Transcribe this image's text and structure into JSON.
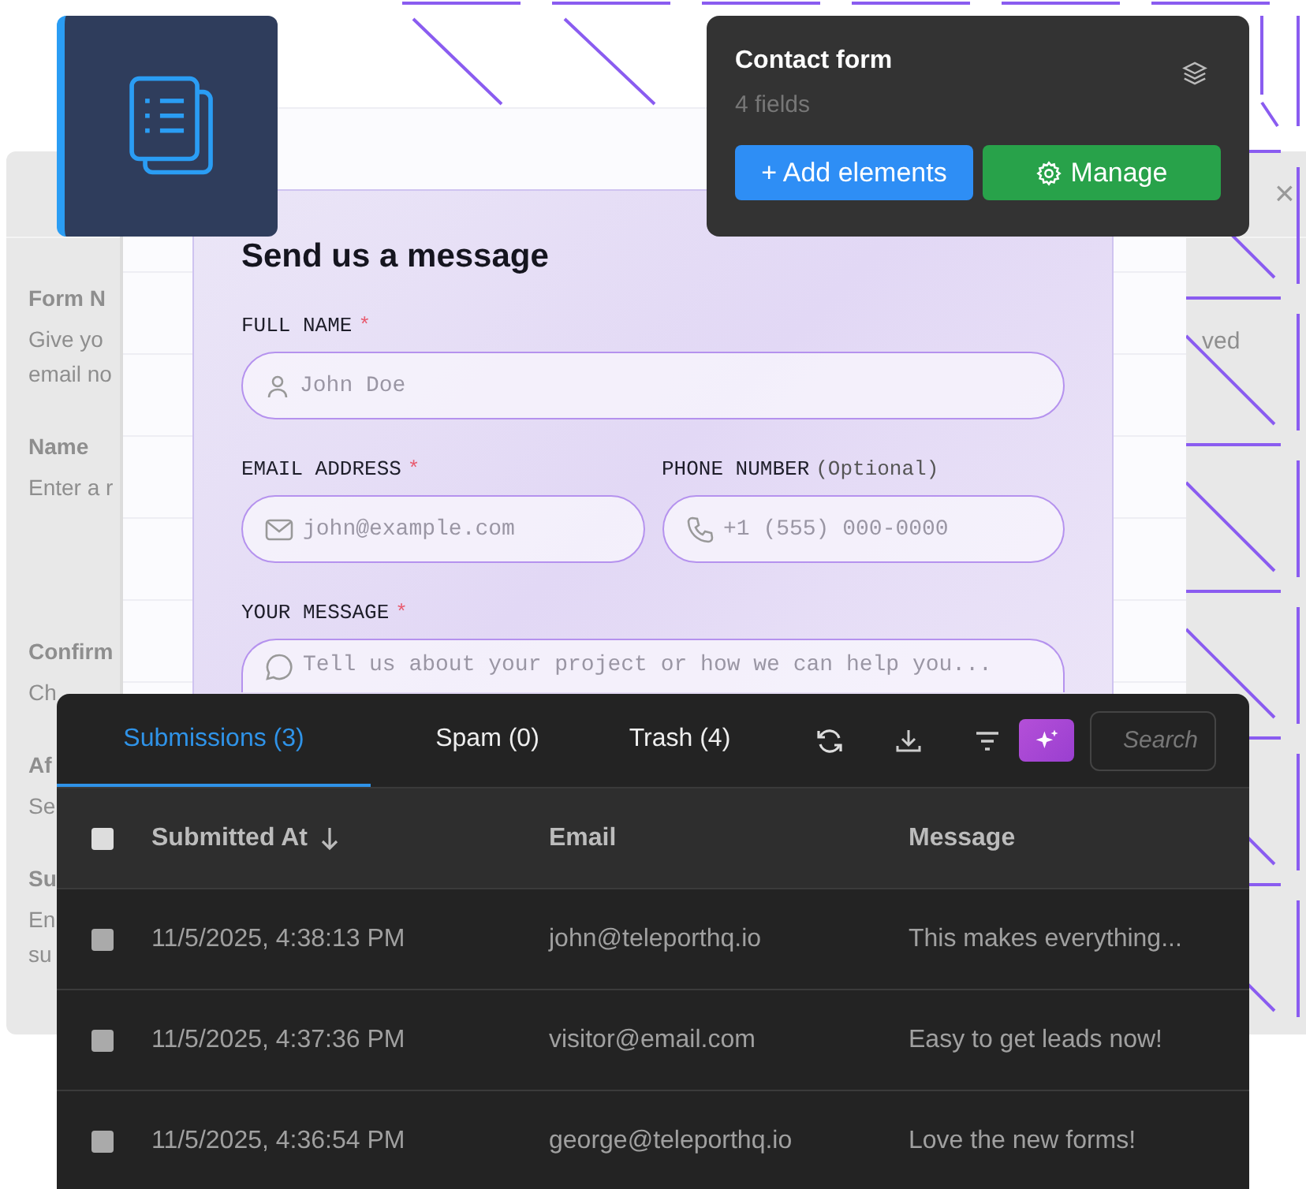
{
  "background_panel": {
    "texts": [
      {
        "text": "Form N",
        "kind": "heading"
      },
      {
        "text": "Give yo",
        "kind": "hint"
      },
      {
        "text": "email no",
        "kind": "hint"
      },
      {
        "text": "Name",
        "kind": "heading"
      },
      {
        "text": "Enter a r",
        "kind": "hint"
      },
      {
        "text": "Confirm",
        "kind": "heading"
      },
      {
        "text": "Ch",
        "kind": "hint"
      },
      {
        "text": "Af",
        "kind": "heading"
      },
      {
        "text": "Se",
        "kind": "hint"
      },
      {
        "text": "Su",
        "kind": "heading"
      },
      {
        "text": "En",
        "kind": "hint"
      },
      {
        "text": "su",
        "kind": "hint"
      }
    ],
    "side_text": "ved",
    "close": "×"
  },
  "popover": {
    "title": "Contact form",
    "subtitle": "4 fields",
    "buttons": [
      {
        "label": "+ Add elements",
        "kind": "add"
      },
      {
        "label": "Manage",
        "kind": "manage"
      }
    ]
  },
  "form": {
    "title": "Send us a message",
    "fields": [
      {
        "label": "FULL NAME",
        "marker": "*",
        "placeholder": "John Doe",
        "kind": "name"
      },
      {
        "label": "EMAIL ADDRESS",
        "marker": "*",
        "placeholder": "john@example.com",
        "kind": "email"
      },
      {
        "label": "PHONE NUMBER",
        "note": "(Optional)",
        "placeholder": "+1 (555) 000-0000",
        "kind": "phone"
      },
      {
        "label": "YOUR MESSAGE",
        "marker": "*",
        "placeholder": "Tell us about your project or how we can help you...",
        "kind": "message"
      }
    ]
  },
  "table": {
    "tabs": [
      {
        "label": "Submissions (3)",
        "selected": true
      },
      {
        "label": "Spam (0)",
        "selected": false
      },
      {
        "label": "Trash (4)",
        "selected": false
      }
    ],
    "search": {
      "placeholder": "Search"
    },
    "select_all": {
      "checked": false
    },
    "columns": [
      "Submitted At",
      "Email",
      "Message"
    ],
    "rows": [
      {
        "checked": false,
        "submitted_at": "11/5/2025, 4:38:13 PM",
        "email": "john@teleporthq.io",
        "message": "This makes everything..."
      },
      {
        "checked": false,
        "submitted_at": "11/5/2025, 4:37:36 PM",
        "email": "visitor@email.com",
        "message": "Easy to get leads now!"
      },
      {
        "checked": false,
        "submitted_at": "11/5/2025, 4:36:54 PM",
        "email": "george@teleporthq.io",
        "message": "Love the new forms!"
      }
    ]
  }
}
